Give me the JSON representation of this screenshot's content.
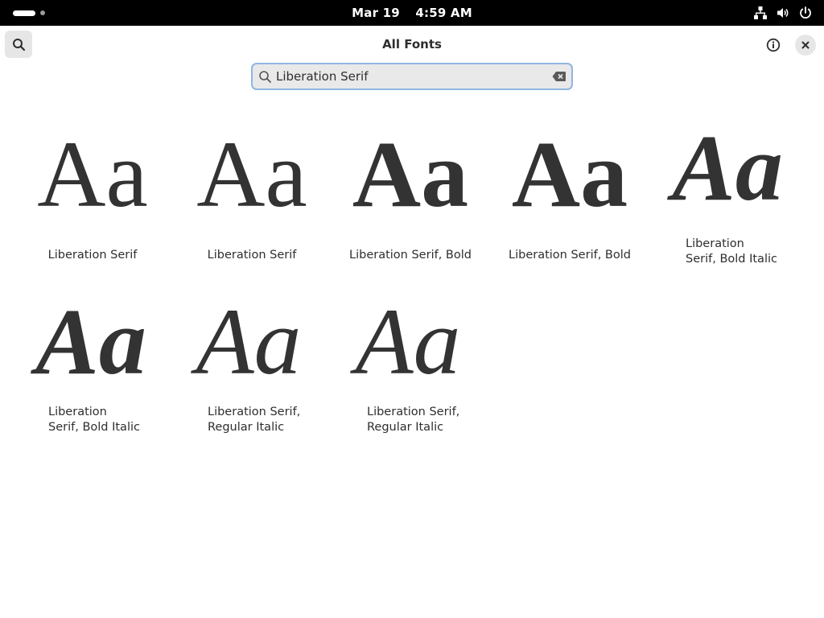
{
  "topbar": {
    "date": "Mar 19",
    "time": "4:59 AM",
    "tray_icons": [
      "network-icon",
      "volume-icon",
      "power-icon"
    ]
  },
  "header": {
    "title": "All Fonts"
  },
  "search": {
    "value": "Liberation Serif",
    "placeholder": ""
  },
  "fonts": [
    {
      "sample": "Aa",
      "label": "Liberation Serif"
    },
    {
      "sample": "Aa",
      "label": "Liberation Serif"
    },
    {
      "sample": "Aa",
      "label": "Liberation Serif, Bold"
    },
    {
      "sample": "Aa",
      "label": "Liberation Serif, Bold"
    },
    {
      "sample": "Aa",
      "label_line1": "Liberation",
      "label_line2": "Serif, Bold Italic"
    },
    {
      "sample": "Aa",
      "label_line1": "Liberation",
      "label_line2": "Serif, Bold Italic"
    },
    {
      "sample": "Aa",
      "label_line1": "Liberation Serif,",
      "label_line2": "Regular Italic"
    },
    {
      "sample": "Aa",
      "label_line1": "Liberation Serif,",
      "label_line2": "Regular Italic"
    }
  ],
  "colors": {
    "topbar_bg": "#000000",
    "search_focus_border": "#8fb6e0",
    "button_bg": "#e6e6e6",
    "text": "#2e2e2e"
  }
}
